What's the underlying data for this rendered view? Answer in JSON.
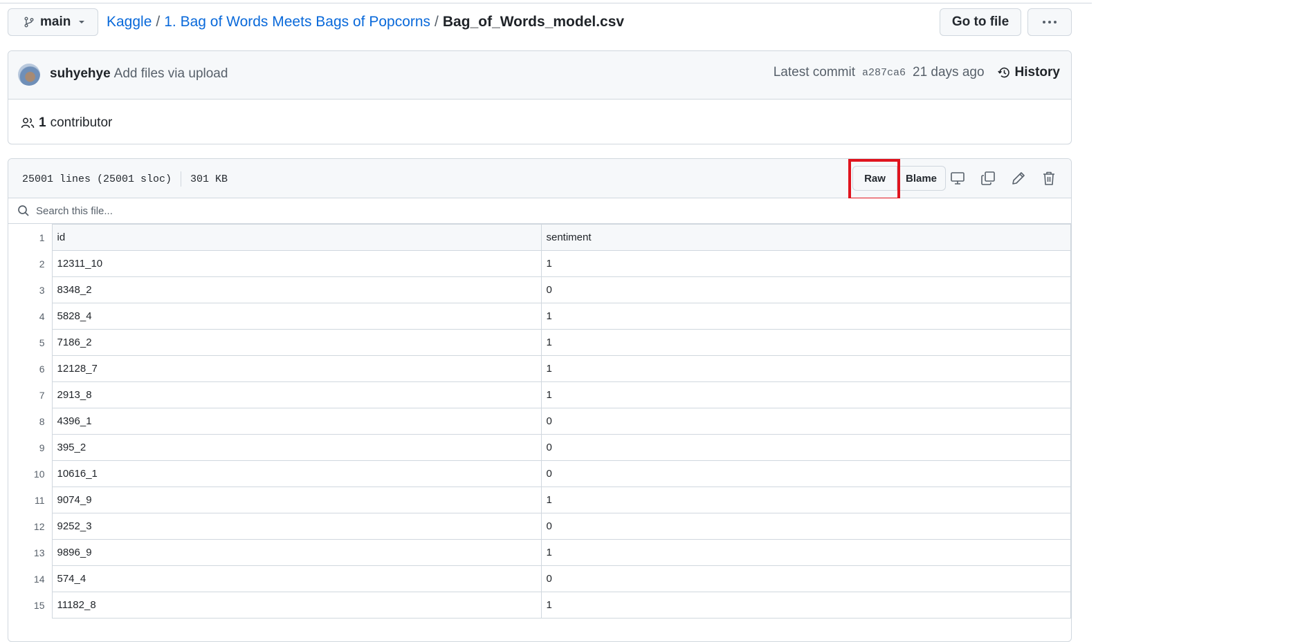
{
  "branch": {
    "name": "main"
  },
  "breadcrumb": {
    "repo": "Kaggle",
    "folder": "1. Bag of Words Meets Bags of Popcorns",
    "file": "Bag_of_Words_model.csv",
    "separator": "/"
  },
  "header_actions": {
    "go_to_file": "Go to file",
    "more_icon": "kebab-horizontal-icon"
  },
  "commit": {
    "author": "suhyehye",
    "message": "Add files via upload",
    "latest_label": "Latest commit",
    "hash": "a287ca6",
    "age": "21 days ago",
    "history_label": "History",
    "contributor_count": "1",
    "contributor_label": "contributor"
  },
  "file": {
    "lines": "25001 lines (25001 sloc)",
    "size": "301 KB",
    "raw_label": "Raw",
    "blame_label": "Blame",
    "highlight_color": "#e0141e",
    "tools": [
      "display-icon",
      "copy-icon",
      "pencil-icon",
      "trash-icon"
    ]
  },
  "search": {
    "placeholder": "Search this file..."
  },
  "table": {
    "header": {
      "line": "1",
      "cells": [
        "id",
        "sentiment"
      ]
    },
    "rows": [
      {
        "line": "2",
        "cells": [
          "12311_10",
          "1"
        ]
      },
      {
        "line": "3",
        "cells": [
          "8348_2",
          "0"
        ]
      },
      {
        "line": "4",
        "cells": [
          "5828_4",
          "1"
        ]
      },
      {
        "line": "5",
        "cells": [
          "7186_2",
          "1"
        ]
      },
      {
        "line": "6",
        "cells": [
          "12128_7",
          "1"
        ]
      },
      {
        "line": "7",
        "cells": [
          "2913_8",
          "1"
        ]
      },
      {
        "line": "8",
        "cells": [
          "4396_1",
          "0"
        ]
      },
      {
        "line": "9",
        "cells": [
          "395_2",
          "0"
        ]
      },
      {
        "line": "10",
        "cells": [
          "10616_1",
          "0"
        ]
      },
      {
        "line": "11",
        "cells": [
          "9074_9",
          "1"
        ]
      },
      {
        "line": "12",
        "cells": [
          "9252_3",
          "0"
        ]
      },
      {
        "line": "13",
        "cells": [
          "9896_9",
          "1"
        ]
      },
      {
        "line": "14",
        "cells": [
          "574_4",
          "0"
        ]
      },
      {
        "line": "15",
        "cells": [
          "11182_8",
          "1"
        ]
      }
    ]
  },
  "colors": {
    "link": "#0969da",
    "border": "#d0d7de",
    "muted": "#57606a",
    "subtle_bg": "#f6f8fa"
  }
}
